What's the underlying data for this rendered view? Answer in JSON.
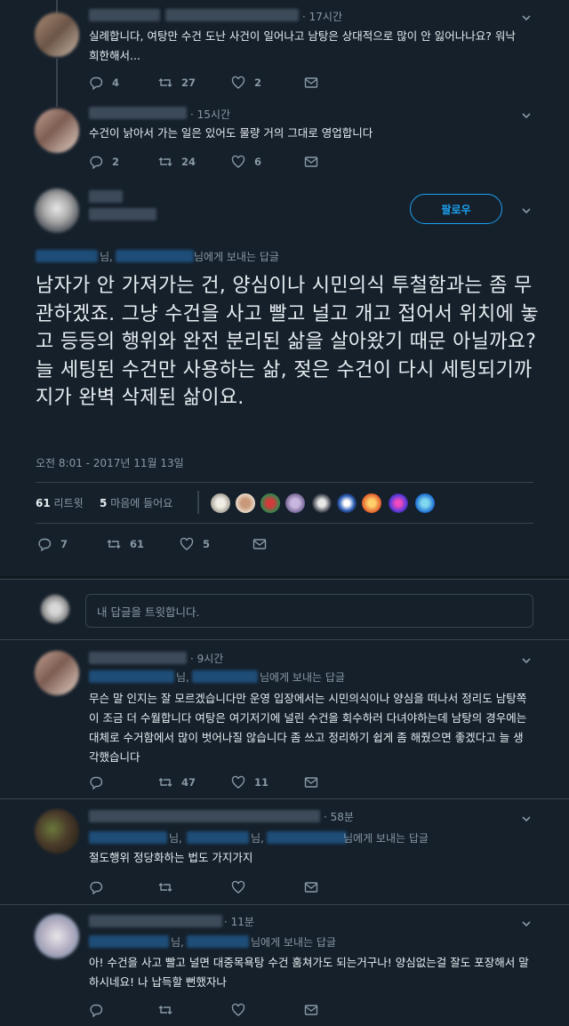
{
  "colors": {
    "background": "#15202b",
    "accent": "#1da1f2",
    "muted": "#8899a6",
    "text": "#e6ecf0"
  },
  "tweet1": {
    "time": "· 17시간",
    "text": "실례합니다, 여탕만 수건 도난 사건이 일어나고 남탕은 상대적으로 많이 안 잃어나나요? 워낙 희한해서...",
    "replies": "4",
    "retweets": "27",
    "likes": "2"
  },
  "tweet2": {
    "time": "· 15시간",
    "text": "수건이 낡아서 가는 일은 있어도 물량 거의 그대로 영업합니다",
    "replies": "2",
    "retweets": "24",
    "likes": "6"
  },
  "main": {
    "follow_label": "팔로우",
    "reply_to_mid": "님,",
    "reply_to_suffix": "님에게 보내는 답글",
    "text": "남자가 안 가져가는 건, 양심이나 시민의식 투철함과는 좀 무관하겠죠. 그냥 수건을 사고 빨고 널고 개고 접어서 위치에 놓고 등등의 행위와 완전 분리된 삶을 살아왔기 때문 아닐까요? 늘 세팅된 수건만 사용하는 삶, 젖은 수건이 다시 세팅되기까지가 완벽 삭제된 삶이요.",
    "timestamp": "오전 8:01 - 2017년 11월 13일",
    "retweet_count": "61",
    "retweet_label": "리트윗",
    "like_count": "5",
    "like_label": "마음에 들어요",
    "replies": "7",
    "retweets": "61",
    "likes": "5"
  },
  "compose": {
    "placeholder": "내 답글을 트윗합니다."
  },
  "reply1": {
    "time": "· 9시간",
    "reply_to_mid": "님,",
    "reply_to_suffix": "님에게 보내는 답글",
    "text": "무슨 말 인지는 잘 모르겠습니다만 운영 입장에서는 시민의식이나 양심을 떠나서 정리도 남탕쪽이 조금 더 수월합니다 여탕은 여기저기에 널린 수건을 회수하러 다녀야하는데 남탕의 경우에는 대체로 수거함에서 많이 벗어나질 않습니다 좀 쓰고 정리하기 쉽게 좀 해줬으면 좋겠다고 늘 생각했습니다",
    "replies": "",
    "retweets": "47",
    "likes": "11"
  },
  "reply2": {
    "time": "· 58분",
    "reply_to_a": "님,",
    "reply_to_b": "님,",
    "reply_to_suffix": "님에게 보내는 답글",
    "text": "절도행위 정당화하는 법도 가지가지",
    "replies": "",
    "retweets": "",
    "likes": ""
  },
  "reply3": {
    "time": "· 11분",
    "reply_to_mid": "님,",
    "reply_to_suffix": "님에게 보내는 답글",
    "text": "아! 수건을 사고 빨고 널면 대중목욕탕 수건 훔쳐가도 되는거구나! 양심없는걸 잘도 포장해서 말하시네요! 나 납득할 뻔했자나",
    "replies": "",
    "retweets": "",
    "likes": ""
  }
}
